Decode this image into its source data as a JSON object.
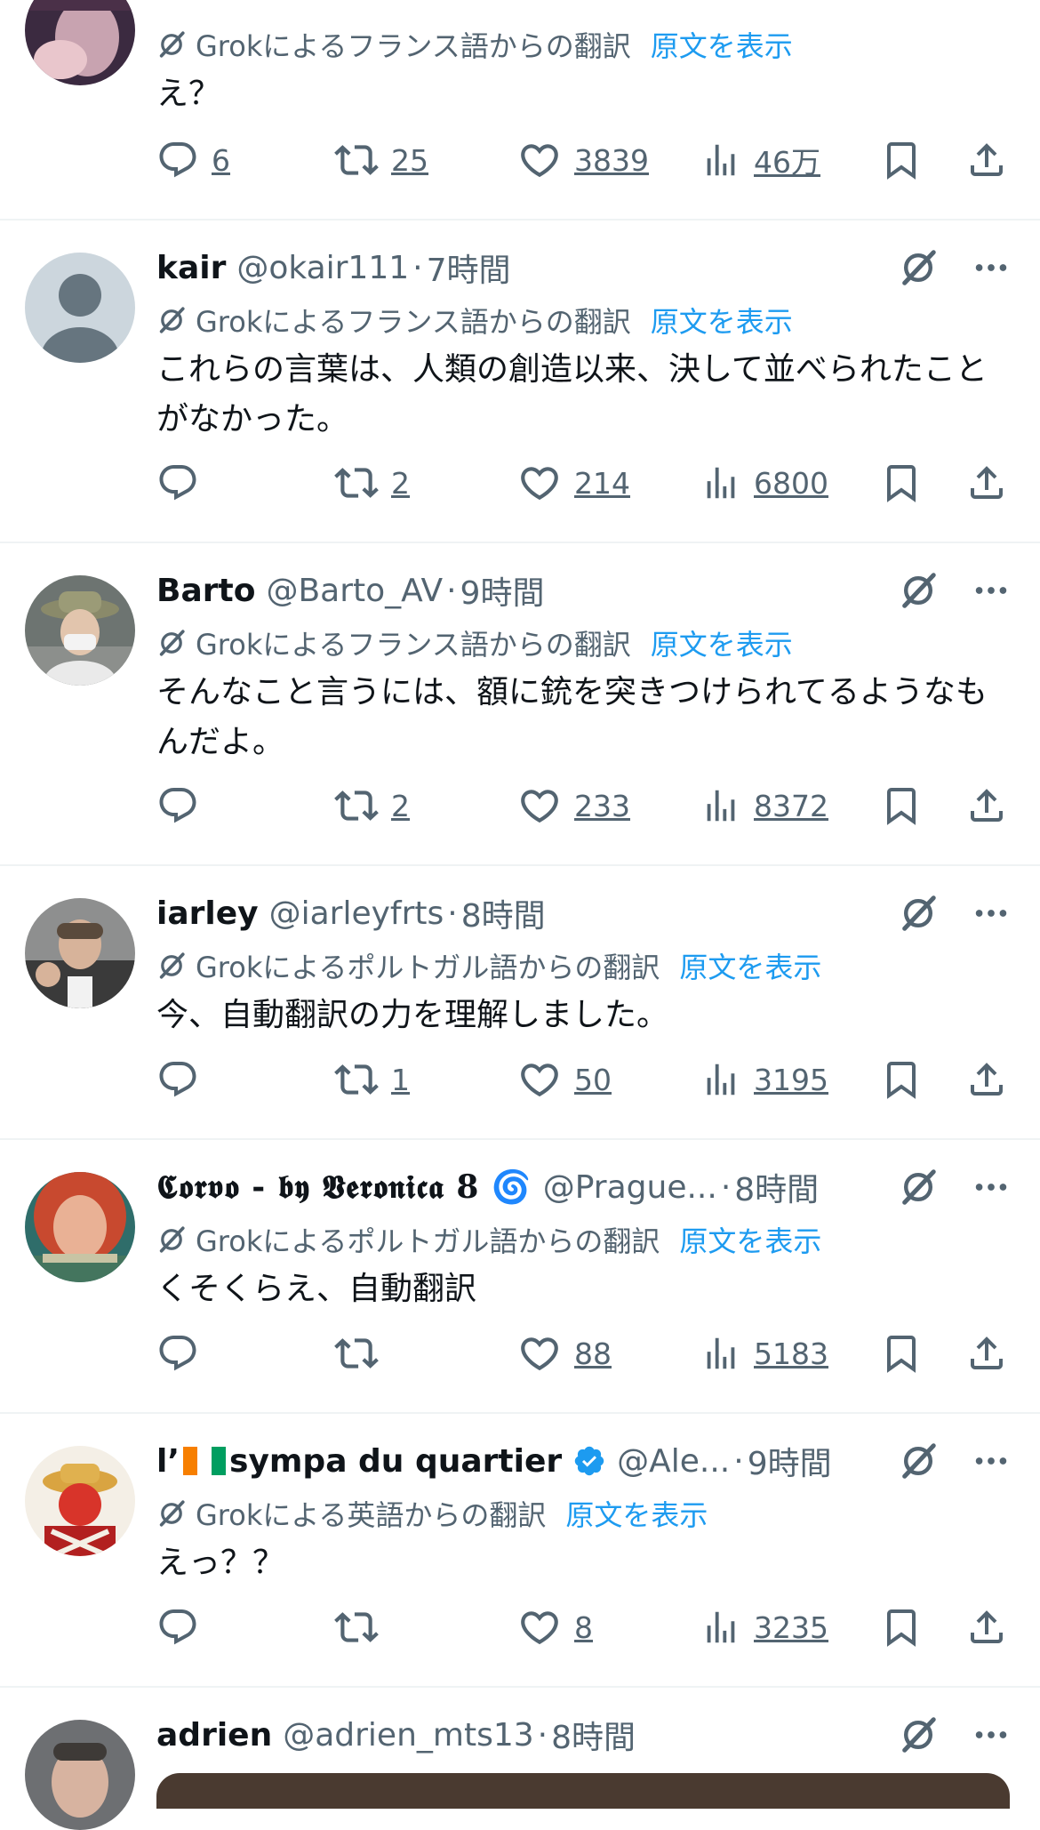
{
  "common": {
    "show_original": "原文を表示",
    "icons": {
      "reply": "reply-icon",
      "retweet": "retweet-icon",
      "like": "heart-icon",
      "views": "views-icon",
      "bookmark": "bookmark-icon",
      "share": "share-icon",
      "grok": "grok-icon",
      "more": "more-icon"
    },
    "colors": {
      "text": "#0f1419",
      "muted": "#536471",
      "link": "#1d9bf0",
      "divider": "#eff3f4"
    }
  },
  "tweets": [
    {
      "translation_note": "Grokによるフランス語からの翻訳",
      "text": "え？",
      "replies": "6",
      "retweets": "25",
      "likes": "3839",
      "views": "46万"
    },
    {
      "name": "kair",
      "handle": "@okair111",
      "sep": "·",
      "time": "7時間",
      "translation_note": "Grokによるフランス語からの翻訳",
      "text": "これらの言葉は、人類の創造以来、決して並べられたことがなかった。",
      "replies": "",
      "retweets": "2",
      "likes": "214",
      "views": "6800"
    },
    {
      "name": "Barto",
      "handle": "@Barto_AV",
      "sep": "·",
      "time": "9時間",
      "translation_note": "Grokによるフランス語からの翻訳",
      "text": "そんなこと言うには、額に銃を突きつけられてるようなもんだよ。",
      "replies": "",
      "retweets": "2",
      "likes": "233",
      "views": "8372"
    },
    {
      "name": "iarley",
      "handle": "@iarleyfrts",
      "sep": "·",
      "time": "8時間",
      "translation_note": "Grokによるポルトガル語からの翻訳",
      "text": "今、自動翻訳の力を理解しました。",
      "replies": "",
      "retweets": "1",
      "likes": "50",
      "views": "3195"
    },
    {
      "name": "𝕮𝖔𝖗𝖛𝖔 - 𝖇𝖞 𝖁𝖊𝖗𝖔𝖓𝖎𝖈𝖆 8 🌀",
      "handle": "@Prague...",
      "sep": "·",
      "time": "8時間",
      "translation_note": "Grokによるポルトガル語からの翻訳",
      "text": "くそくらえ、自動翻訳",
      "replies": "",
      "retweets": "",
      "likes": "88",
      "views": "5183"
    },
    {
      "name_prefix": "l’",
      "name": "sympa du quartier",
      "handle": "@Ale...",
      "sep": "·",
      "time": "9時間",
      "translation_note": "Grokによる英語からの翻訳",
      "text": "えっ？？",
      "replies": "",
      "retweets": "",
      "likes": "8",
      "views": "3235"
    },
    {
      "name": "adrien",
      "handle": "@adrien_mts13",
      "sep": "·",
      "time": "8時間"
    }
  ]
}
